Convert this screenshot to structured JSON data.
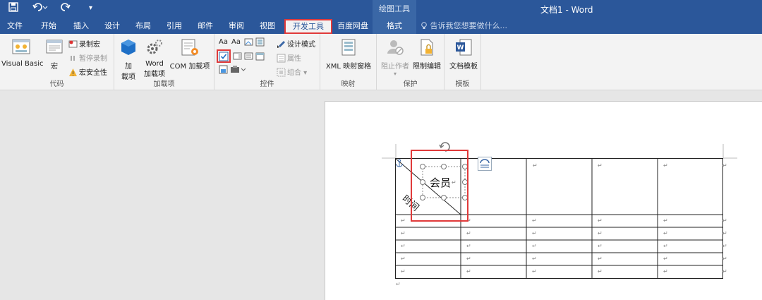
{
  "titlebar": {
    "window_title": "文档1 - Word",
    "context_title": "绘图工具"
  },
  "tabs": [
    {
      "label": "文件"
    },
    {
      "label": "开始"
    },
    {
      "label": "插入"
    },
    {
      "label": "设计"
    },
    {
      "label": "布局"
    },
    {
      "label": "引用"
    },
    {
      "label": "邮件"
    },
    {
      "label": "审阅"
    },
    {
      "label": "视图"
    },
    {
      "label": "开发工具"
    },
    {
      "label": "百度网盘"
    },
    {
      "label": "格式"
    }
  ],
  "tellme": "告诉我您想要做什么...",
  "ribbon": {
    "code": {
      "label": "代码",
      "visual_basic": "Visual Basic",
      "macro": "宏",
      "record_macro": "录制宏",
      "pause_recording": "暂停录制",
      "macro_security": "宏安全性"
    },
    "addins": {
      "label": "加载项",
      "add": "加",
      "add2": "载项",
      "word_addins1": "Word",
      "word_addins2": "加载项",
      "com_addins": "COM 加载项"
    },
    "controls": {
      "label": "控件",
      "design_mode": "设计模式",
      "properties": "属性",
      "group": "组合"
    },
    "mapping": {
      "label": "映射",
      "xml_pane": "XML 映射窗格"
    },
    "protect": {
      "label": "保护",
      "block_authors": "阻止作者",
      "restrict_editing": "限制编辑"
    },
    "templates": {
      "label": "模板",
      "document_template": "文档模板"
    }
  },
  "document": {
    "textbox_text": "会员",
    "diagonal_text": "时间",
    "paragraph_mark": "↵"
  }
}
